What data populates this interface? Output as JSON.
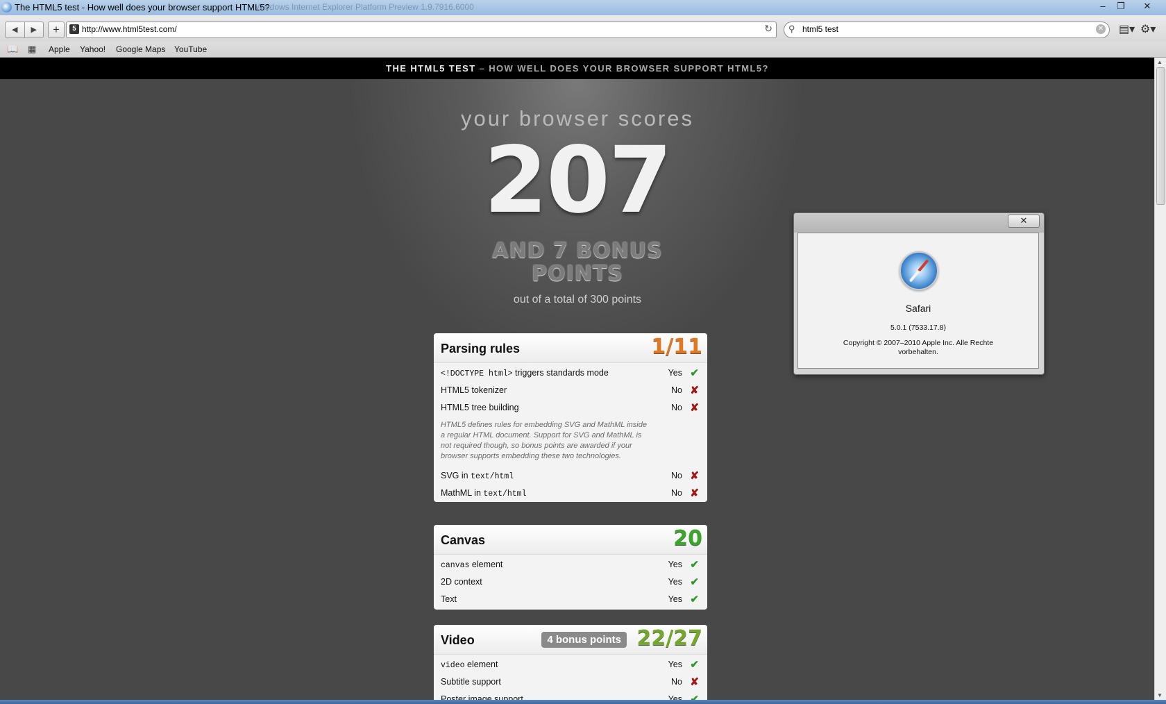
{
  "window": {
    "title": "The HTML5 test - How well does your browser support HTML5?",
    "background_title": "Windows Internet Explorer Platform Preview 1.9.7916.6000",
    "minimize": "–",
    "restore": "❐",
    "close": "✕"
  },
  "toolbar": {
    "back": "◀",
    "forward": "▶",
    "add": "+",
    "favicon": "5",
    "url": "http://www.html5test.com/",
    "reload": "↻",
    "search_icon": "⚲",
    "search_query": "html5 test",
    "search_clear": "✕",
    "page_menu": "▤▾",
    "settings_menu": "⚙▾"
  },
  "bookmarks": {
    "reading_list_icon": "📖",
    "top_sites_icon": "▦",
    "items": [
      "Apple",
      "Yahoo!",
      "Google Maps",
      "YouTube"
    ]
  },
  "page": {
    "header_bold": "THE HTML5 TEST",
    "header_rest": " – HOW WELL DOES YOUR BROWSER SUPPORT HTML5?",
    "scores_label": "your browser scores",
    "score": "207",
    "bonus_line1": "AND 7 BONUS",
    "bonus_line2": "POINTS",
    "total": "out of a total of 300 points"
  },
  "sections": {
    "parsing": {
      "title": "Parsing rules",
      "score": "1/11",
      "score_color": "#e6761d",
      "rows": [
        {
          "code": "<!DOCTYPE html>",
          "label": " triggers standards mode",
          "result": "Yes",
          "mark": "✔"
        },
        {
          "label": "HTML5 tokenizer",
          "result": "No",
          "mark": "✘"
        },
        {
          "label": "HTML5 tree building",
          "result": "No",
          "mark": "✘"
        }
      ],
      "note": "HTML5 defines rules for embedding SVG and MathML inside a regular HTML document. Support for SVG and MathML is not required though, so bonus points are awarded if your browser supports embedding these two technologies.",
      "bonus_rows": [
        {
          "label": "SVG in ",
          "code": "text/html",
          "result": "No",
          "mark": "✘"
        },
        {
          "label": "MathML in ",
          "code": "text/html",
          "result": "No",
          "mark": "✘"
        }
      ]
    },
    "canvas": {
      "title": "Canvas",
      "score": "20",
      "score_color": "#3aa62a",
      "rows": [
        {
          "code": "canvas",
          "label": " element",
          "result": "Yes",
          "mark": "✔"
        },
        {
          "label": "2D context",
          "result": "Yes",
          "mark": "✔"
        },
        {
          "label": "Text",
          "result": "Yes",
          "mark": "✔"
        }
      ]
    },
    "video": {
      "title": "Video",
      "bonus": "4 bonus points",
      "score": "22/27",
      "score_color": "#74a82a",
      "rows": [
        {
          "code": "video",
          "label": " element",
          "result": "Yes",
          "mark": "✔"
        },
        {
          "label": "Subtitle support",
          "result": "No",
          "mark": "✘"
        },
        {
          "label": "Poster image support",
          "result": "Yes",
          "mark": "✔"
        }
      ]
    }
  },
  "about_dialog": {
    "close": "✕",
    "app_name": "Safari",
    "version": "5.0.1 (7533.17.8)",
    "copyright": "Copyright © 2007–2010 Apple Inc. Alle Rechte vorbehalten."
  },
  "scrollbar": {
    "up": "▲",
    "down": "▼"
  }
}
